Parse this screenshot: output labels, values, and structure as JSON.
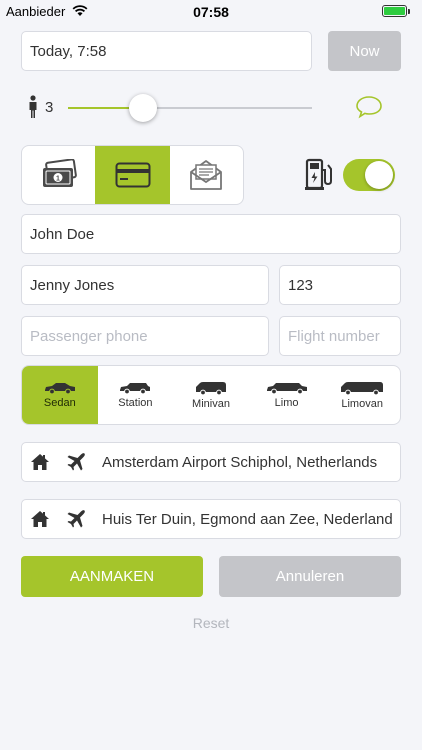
{
  "status_bar": {
    "carrier": "Aanbieder",
    "time": "07:58"
  },
  "datetime": {
    "value": "Today, 7:58",
    "now_label": "Now"
  },
  "passengers": {
    "count": "3",
    "level": 0.3
  },
  "payment": {
    "options": [
      "cash-icon",
      "credit-card-icon",
      "invoice-icon"
    ],
    "selected": "credit-card-icon"
  },
  "electric": {
    "enabled": true
  },
  "contact": {
    "name": "John Doe"
  },
  "passenger": {
    "name": "Jenny Jones",
    "number": "123",
    "phone_placeholder": "Passenger phone",
    "flight_placeholder": "Flight number"
  },
  "vehicles": {
    "items": [
      "Sedan",
      "Station",
      "Minivan",
      "Limo",
      "Limovan"
    ],
    "selected": "Sedan"
  },
  "route": {
    "pickup": "Amsterdam Airport Schiphol, Netherlands",
    "dropoff": "Huis Ter Duin, Egmond aan Zee, Nederland"
  },
  "actions": {
    "create": "AANMAKEN",
    "cancel": "Annuleren",
    "reset": "Reset"
  },
  "colors": {
    "accent": "#a5c52b",
    "disabled": "#c4c5c9",
    "background": "#f4f5f9"
  }
}
